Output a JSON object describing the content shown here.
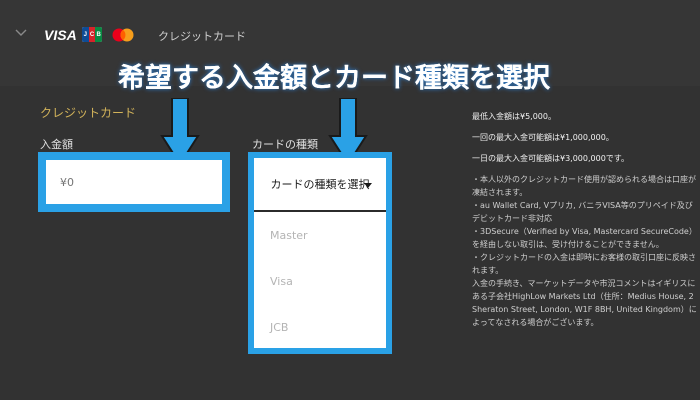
{
  "header": {
    "brands": {
      "visa": "VISA",
      "jcb": "JCB",
      "mastercard_icon": "mastercard-logo"
    },
    "title": "クレジットカード"
  },
  "overlay": {
    "headline": "希望する入金額とカード種類を選択",
    "arrow_color": "#2aa1e6"
  },
  "form": {
    "section_title": "クレジットカード",
    "amount": {
      "label": "入金額",
      "placeholder": "¥0"
    },
    "card_type": {
      "label": "カードの種類",
      "selected": "カードの種類を選択",
      "options": [
        "Master",
        "Visa",
        "JCB"
      ]
    }
  },
  "info": {
    "limits": [
      "最低入金額は¥5,000。",
      "一回の最大入金可能額は¥1,000,000。",
      "一日の最大入金可能額は¥3,000,000です。"
    ],
    "notes": [
      "・本人以外のクレジットカード使用が認められる場合は口座が凍結されます。",
      "・au Wallet Card, Vプリカ, バニラVISA等のプリペイド及びデビットカード非対応",
      "・3DSecure（Verified by Visa, Mastercard SecureCode）を経由しない取引は、受け付けることができません。",
      "・クレジットカードの入金は即時にお客様の取引口座に反映されます。",
      "入金の手続き、マーケットデータや市況コメントはイギリスにある子会社HighLow Markets Ltd（住所：Medius House, 2 Sheraton Street, London, W1F 8BH, United Kingdom）によってなされる場合がございます。"
    ]
  },
  "colors": {
    "background": "#323232",
    "accent_blue": "#2aa1e6",
    "section_title": "#d2b35a"
  }
}
